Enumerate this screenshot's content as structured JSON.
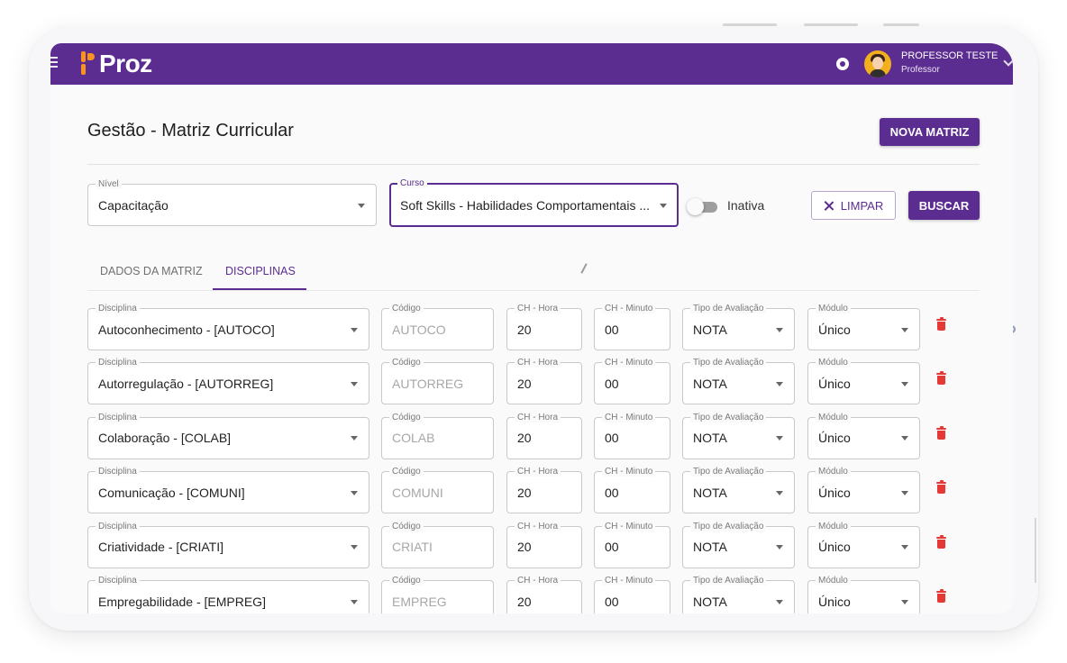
{
  "app": {
    "logo_text": "Proz"
  },
  "header": {
    "user_name": "PROFESSOR TESTE",
    "user_role": "Professor"
  },
  "page": {
    "title": "Gestão - Matriz Curricular",
    "new_button": "NOVA MATRIZ"
  },
  "filters": {
    "nivel": {
      "label": "Nível",
      "value": "Capacitação"
    },
    "curso": {
      "label": "Curso",
      "value": "Soft Skills - Habilidades Comportamentais ..."
    },
    "toggle": {
      "label": "Inativa",
      "on": false
    },
    "clear_button": "LIMPAR",
    "search_button": "BUSCAR"
  },
  "tabs": [
    {
      "label": "DADOS DA MATRIZ",
      "active": false
    },
    {
      "label": "DISCIPLINAS",
      "active": true
    }
  ],
  "columns": {
    "disciplina": "Disciplina",
    "codigo": "Código",
    "ch_hora": "CH - Hora",
    "ch_minuto": "CH - Minuto",
    "tipo": "Tipo de Avaliação",
    "modulo": "Módulo"
  },
  "rows": [
    {
      "disciplina": "Autoconhecimento - [AUTOCO]",
      "codigo": "AUTOCO",
      "ch_hora": "20",
      "ch_minuto": "00",
      "tipo": "NOTA",
      "modulo": "Único"
    },
    {
      "disciplina": "Autorregulação - [AUTORREG]",
      "codigo": "AUTORREG",
      "ch_hora": "20",
      "ch_minuto": "00",
      "tipo": "NOTA",
      "modulo": "Único"
    },
    {
      "disciplina": "Colaboração - [COLAB]",
      "codigo": "COLAB",
      "ch_hora": "20",
      "ch_minuto": "00",
      "tipo": "NOTA",
      "modulo": "Único"
    },
    {
      "disciplina": "Comunicação - [COMUNI]",
      "codigo": "COMUNI",
      "ch_hora": "20",
      "ch_minuto": "00",
      "tipo": "NOTA",
      "modulo": "Único"
    },
    {
      "disciplina": "Criatividade - [CRIATI]",
      "codigo": "CRIATI",
      "ch_hora": "20",
      "ch_minuto": "00",
      "tipo": "NOTA",
      "modulo": "Único"
    },
    {
      "disciplina": "Empregabilidade - [EMPREG]",
      "codigo": "EMPREG",
      "ch_hora": "20",
      "ch_minuto": "00",
      "tipo": "NOTA",
      "modulo": "Único"
    }
  ],
  "colors": {
    "brand": "#5b2d91",
    "logo_accent": "#f7931e",
    "delete": "#e53935"
  },
  "icons": {
    "menu": "menu-icon",
    "notification": "bell-icon",
    "avatar": "avatar",
    "clear": "close-icon",
    "dropdown": "chevron-down-icon",
    "delete": "trash-icon"
  }
}
